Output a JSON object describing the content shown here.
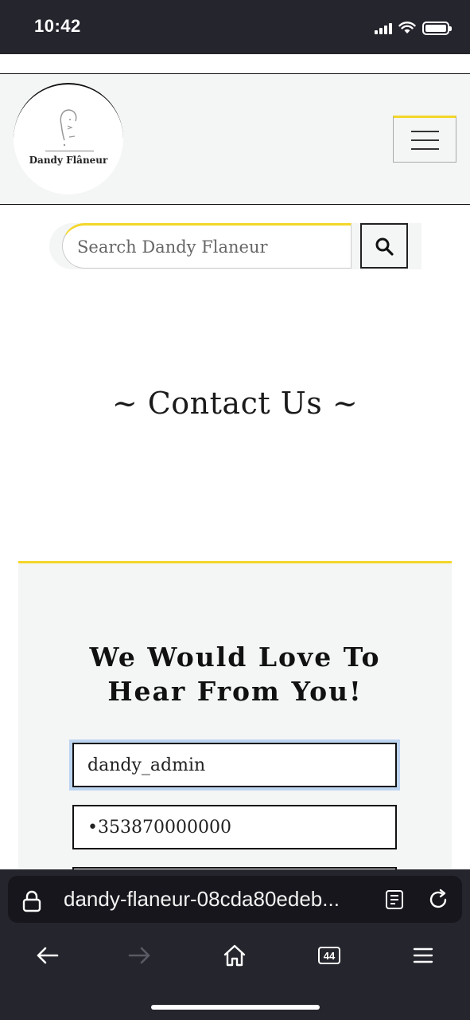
{
  "status_bar": {
    "time": "10:42",
    "icons": [
      "cellular-signal-icon",
      "wifi-icon",
      "battery-icon"
    ]
  },
  "header": {
    "logo_text": "Dandy Flâneur",
    "menu_icon": "hamburger-menu-icon",
    "accent_color": "#f3d62a"
  },
  "search": {
    "placeholder": "Search Dandy Flaneur",
    "button_icon": "search-icon"
  },
  "page": {
    "title": "~ Contact Us ~"
  },
  "contact": {
    "heading_line1": "We Would Love To",
    "heading_line2": "Hear From You!",
    "name_value": "dandy_admin",
    "phone_value": "•353870000000"
  },
  "browser": {
    "url": "dandy-flaneur-08cda80edeb...",
    "tab_count": "44",
    "icons": [
      "lock-icon",
      "reader-mode-icon",
      "reload-icon",
      "back-arrow-icon",
      "forward-arrow-icon",
      "home-icon",
      "tabs-icon",
      "menu-icon"
    ]
  }
}
